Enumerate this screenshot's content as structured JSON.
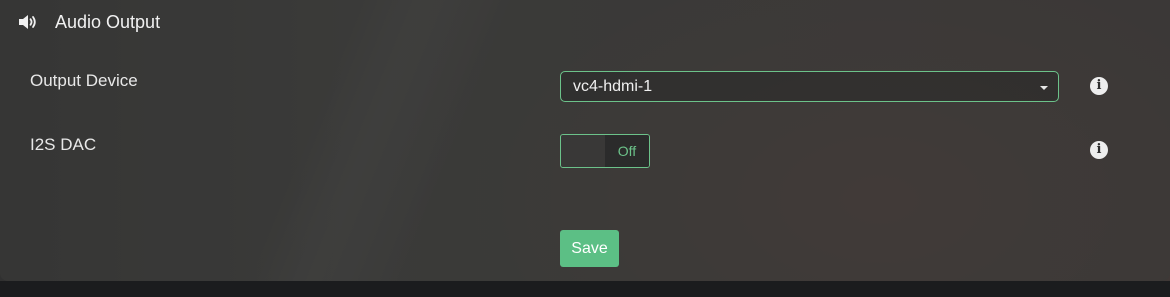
{
  "header": {
    "icon": "speaker-volume-icon",
    "title": "Audio Output"
  },
  "fields": {
    "output_device": {
      "label": "Output Device",
      "value": "vc4-hdmi-1",
      "info_icon": "info-icon"
    },
    "i2s_dac": {
      "label": "I2S DAC",
      "state": "Off",
      "info_icon": "info-icon"
    }
  },
  "actions": {
    "save_label": "Save"
  },
  "colors": {
    "accent": "#5cbf85",
    "accent_border": "#6cc28a",
    "text": "#e8e8e8"
  }
}
